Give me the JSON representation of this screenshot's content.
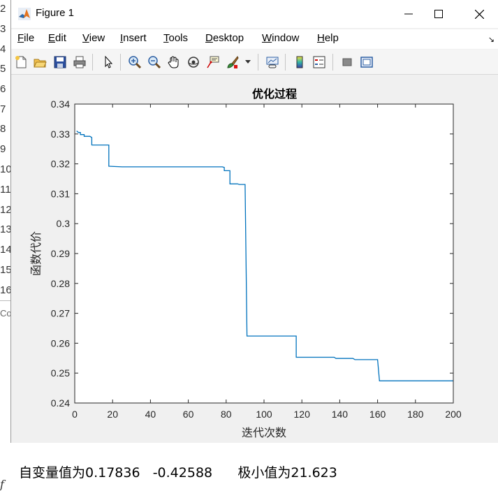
{
  "window": {
    "title": "Figure 1",
    "minimize_glyph": "─",
    "maximize_glyph": "☐",
    "close_glyph": "✕"
  },
  "menu": {
    "items": [
      {
        "key": "F",
        "rest": "ile"
      },
      {
        "key": "E",
        "rest": "dit"
      },
      {
        "key": "V",
        "rest": "iew"
      },
      {
        "key": "I",
        "rest": "nsert"
      },
      {
        "key": "T",
        "rest": "ools"
      },
      {
        "key": "D",
        "rest": "esktop"
      },
      {
        "key": "W",
        "rest": "indow"
      },
      {
        "key": "H",
        "rest": "elp"
      }
    ],
    "overflow_glyph": "↘"
  },
  "toolbar": {
    "icons": [
      "new-figure-icon",
      "open-file-icon",
      "save-icon",
      "print-icon",
      "edit-plot-pointer-icon",
      "zoom-in-icon",
      "zoom-out-icon",
      "pan-hand-icon",
      "rotate-3d-icon",
      "data-cursor-icon",
      "brush-icon",
      "brush-dropdown-icon",
      "link-plot-icon",
      "colorbar-icon",
      "legend-icon",
      "hide-plot-tools-icon",
      "show-plot-tools-icon"
    ]
  },
  "editor": {
    "line_numbers": [
      "2",
      "3",
      "4",
      "5",
      "6",
      "7",
      "8",
      "9",
      "10",
      "11",
      "12",
      "13",
      "14",
      "15",
      "16"
    ],
    "panel_label": "Co",
    "bottom_fragment": "f"
  },
  "console": {
    "text": "自变量值为0.17836   -0.42588      极小值为21.623"
  },
  "chart_data": {
    "type": "line",
    "title": "优化过程",
    "xlabel": "迭代次数",
    "ylabel": "函数代价",
    "xlim": [
      0,
      200
    ],
    "ylim": [
      0.24,
      0.34
    ],
    "xticks": [
      0,
      20,
      40,
      60,
      80,
      100,
      120,
      140,
      160,
      180,
      200
    ],
    "yticks": [
      0.24,
      0.25,
      0.26,
      0.27,
      0.28,
      0.29,
      0.3,
      0.31,
      0.32,
      0.33,
      0.34
    ],
    "grid": false,
    "line_color": "#0072bd",
    "series": [
      {
        "x": [
          1,
          2,
          3,
          3,
          5,
          5,
          8,
          9,
          9,
          17,
          18,
          18,
          25,
          78,
          79,
          79,
          81,
          82,
          82,
          86,
          87,
          87,
          90,
          91,
          91,
          116,
          117,
          117,
          137,
          138,
          138,
          147,
          148,
          148,
          160,
          161,
          161,
          200
        ],
        "y": [
          0.331,
          0.3305,
          0.3305,
          0.3298,
          0.3298,
          0.3292,
          0.3292,
          0.3288,
          0.3263,
          0.3263,
          0.3263,
          0.3192,
          0.319,
          0.319,
          0.3188,
          0.3177,
          0.3177,
          0.3177,
          0.3133,
          0.3133,
          0.3131,
          0.3131,
          0.3131,
          0.2625,
          0.2624,
          0.2624,
          0.2624,
          0.2553,
          0.2553,
          0.2549,
          0.2549,
          0.2549,
          0.2545,
          0.2545,
          0.2545,
          0.2474,
          0.2474,
          0.2474
        ]
      }
    ]
  }
}
